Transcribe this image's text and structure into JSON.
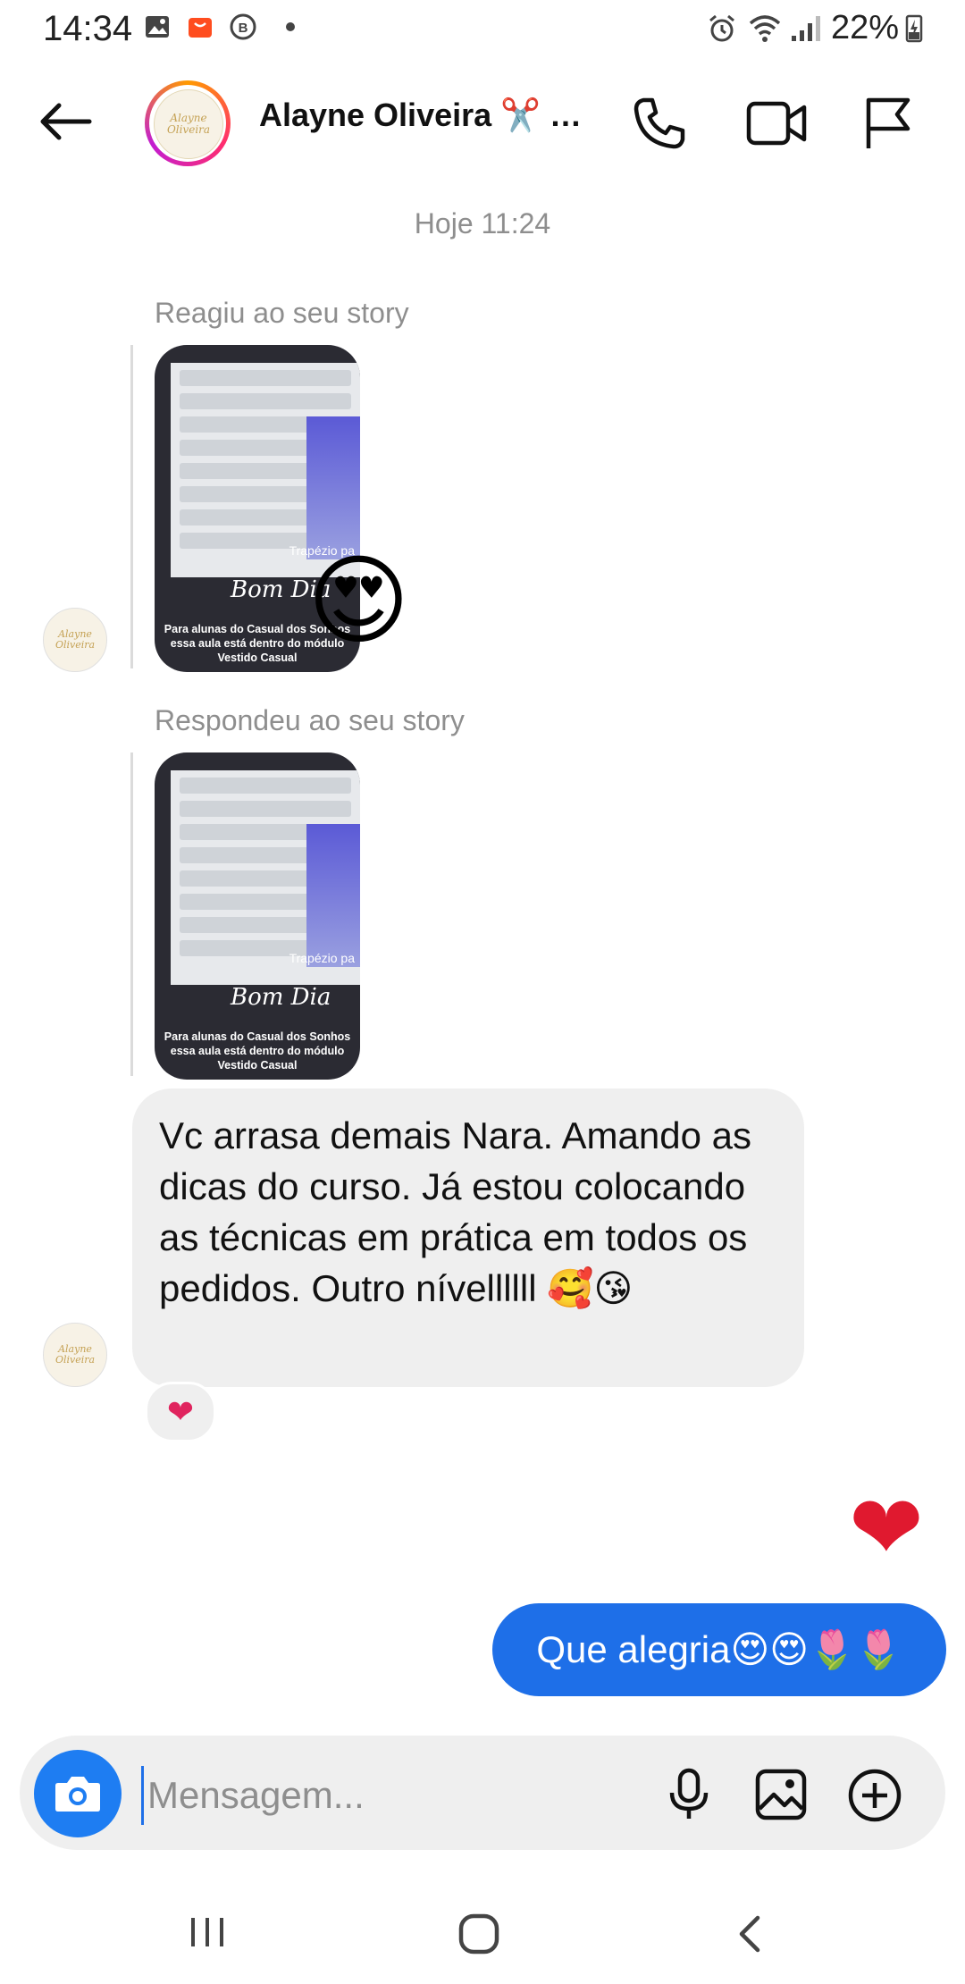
{
  "status_bar": {
    "time": "14:34",
    "battery": "22%"
  },
  "header": {
    "name": "Alayne Oliveira ✂️ …",
    "avatar_text": "Alayne Oliveira"
  },
  "thread": {
    "day_separator": "Hoje 11:24",
    "story_1": {
      "label": "Reagiu ao seu story",
      "reaction_emoji": "😍",
      "story_tag": "Trapézio pa",
      "bom_dia": "Bom Dia",
      "caption": "Para alunas do Casual dos Sonhos essa aula está dentro do módulo Vestido Casual"
    },
    "story_2": {
      "label": "Respondeu ao seu story",
      "story_tag": "Trapézio pa",
      "bom_dia": "Bom Dia",
      "caption": "Para alunas do Casual dos Sonhos essa aula está dentro do módulo Vestido Casual"
    },
    "received_message": "Vc arrasa demais Nara. Amando as dicas do curso. Já estou colocando as técnicas em prática em todos os pedidos. Outro nívellllll 🥰😘",
    "received_reaction": "❤",
    "sent_heart": "❤",
    "sent_message": "Que alegria😍😍🌷🌷"
  },
  "composer": {
    "placeholder": "Mensagem..."
  },
  "colors": {
    "accent": "#1e6fe8",
    "bubble_in": "#efefef",
    "meta_text": "#8e8e8e"
  }
}
